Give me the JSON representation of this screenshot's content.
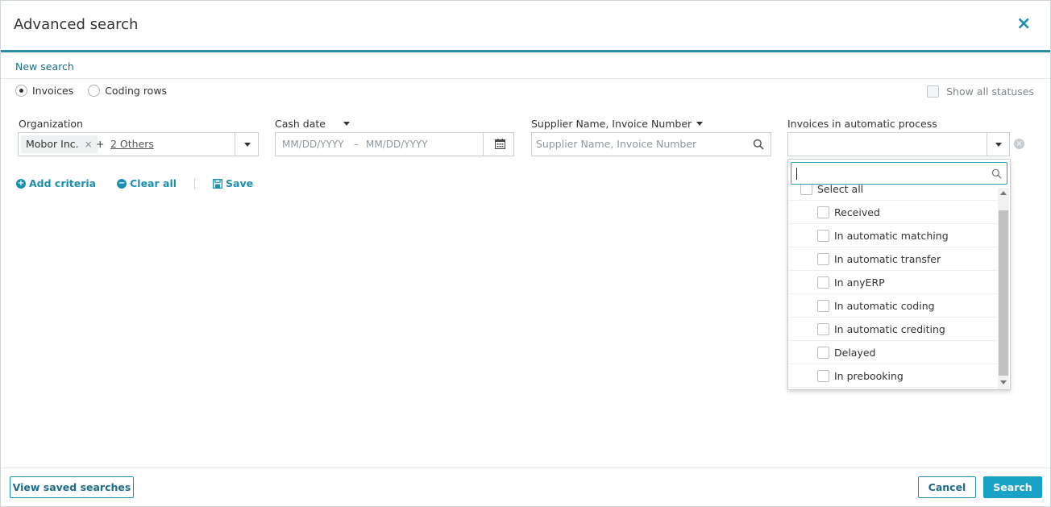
{
  "dialog": {
    "title": "Advanced search",
    "close_icon": "close-icon"
  },
  "tabs": {
    "new_search": "New search"
  },
  "search_type": {
    "options": [
      {
        "label": "Invoices",
        "selected": true
      },
      {
        "label": "Coding rows",
        "selected": false
      }
    ]
  },
  "show_all_statuses": {
    "label": "Show all statuses",
    "checked": false
  },
  "fields": {
    "organization": {
      "label": "Organization",
      "chip": "Mobor Inc.",
      "chip_remove": "×",
      "plus": "+",
      "others": "2 Others"
    },
    "cash_date": {
      "label": "Cash date",
      "from_placeholder": "MM/DD/YYYY",
      "separator": "–",
      "to_placeholder": "MM/DD/YYYY"
    },
    "supplier": {
      "label": "Supplier Name, Invoice Number",
      "placeholder": "Supplier Name, Invoice Number"
    },
    "automatic_process": {
      "label": "Invoices in automatic process",
      "value": ""
    }
  },
  "actions": {
    "add_criteria": "Add criteria",
    "clear_all": "Clear all",
    "save": "Save"
  },
  "dropdown": {
    "search_value": "",
    "select_all": "Select all",
    "options": [
      "Received",
      "In automatic matching",
      "In automatic transfer",
      "In anyERP",
      "In automatic coding",
      "In automatic crediting",
      "Delayed",
      "In prebooking"
    ]
  },
  "footer": {
    "view_saved": "View saved searches",
    "cancel": "Cancel",
    "search": "Search"
  },
  "colors": {
    "accent": "#1b8fb0",
    "primary_button": "#17a2c6",
    "header_border": "#2a8ea6"
  }
}
